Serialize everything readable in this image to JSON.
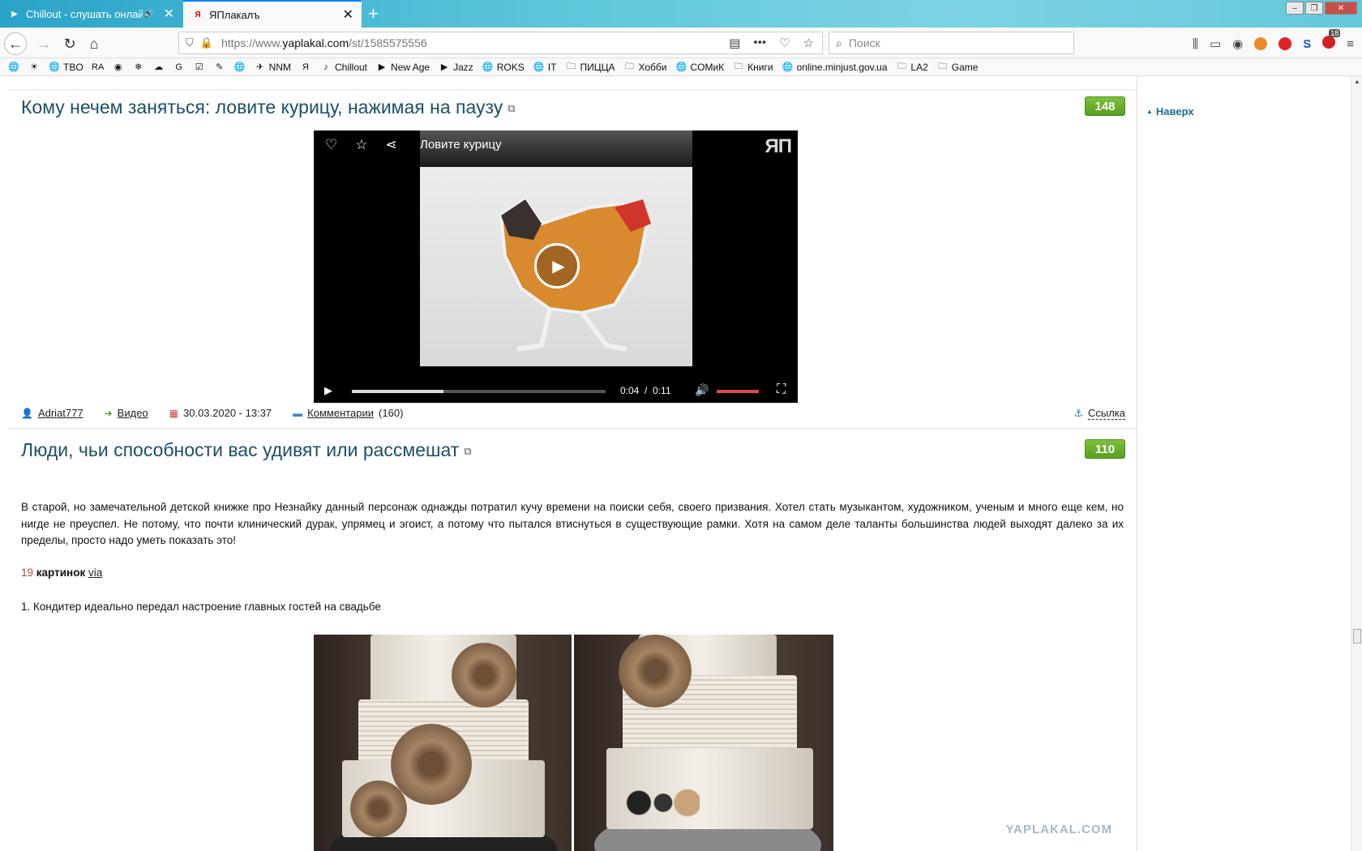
{
  "browser": {
    "tabs": [
      {
        "title": "Chillout - слушать онлай",
        "active": false
      },
      {
        "title": "ЯПлакалъ",
        "active": true
      }
    ],
    "url_prefix": "https://www.",
    "url_domain": "yaplakal.com",
    "url_path": "/st/1585575556",
    "search_placeholder": "Поиск",
    "abp_badge": "18",
    "bookmarks": [
      {
        "label": "",
        "icon": "globe-icon"
      },
      {
        "label": "",
        "icon": "sun-icon"
      },
      {
        "label": "TBO",
        "icon": "globe-icon"
      },
      {
        "label": "",
        "icon": "ra-icon"
      },
      {
        "label": "",
        "icon": "eye-icon"
      },
      {
        "label": "",
        "icon": "snowflake-icon"
      },
      {
        "label": "",
        "icon": "weather-icon"
      },
      {
        "label": "",
        "icon": "g-icon"
      },
      {
        "label": "",
        "icon": "check-icon"
      },
      {
        "label": "",
        "icon": "edit-icon"
      },
      {
        "label": "",
        "icon": "globe-icon"
      },
      {
        "label": "NNM",
        "icon": "bird-icon"
      },
      {
        "label": "",
        "icon": "yap-icon"
      },
      {
        "label": "Chillout",
        "icon": "guitar-icon"
      },
      {
        "label": "New Age",
        "icon": "play-circle-icon"
      },
      {
        "label": "Jazz",
        "icon": "play-circle-icon"
      },
      {
        "label": "ROKS",
        "icon": "globe-icon"
      },
      {
        "label": "IT",
        "icon": "globe-icon"
      },
      {
        "label": "ПИЦЦА",
        "icon": "folder-icon"
      },
      {
        "label": "Хобби",
        "icon": "folder-icon"
      },
      {
        "label": "COMиК",
        "icon": "globe-icon"
      },
      {
        "label": "Книги",
        "icon": "folder-icon"
      },
      {
        "label": "online.minjust.gov.ua",
        "icon": "globe-icon"
      },
      {
        "label": "LA2",
        "icon": "folder-icon"
      },
      {
        "label": "Game",
        "icon": "folder-icon"
      }
    ]
  },
  "sidebar": {
    "up_label": "Наверх"
  },
  "posts": {
    "p1": {
      "title": "Кому нечем заняться: ловите курицу, нажимая на паузу",
      "rating": "148",
      "video_title": "Ловите курицу",
      "video_logo": "ЯП",
      "time_current": "0:04",
      "time_sep": "/",
      "time_total": "0:11",
      "progress_fraction": 0.36,
      "author": "Adriat777",
      "category": "Видео",
      "date": "30.03.2020 - 13:37",
      "comments_label": "Комментарии",
      "comments_count": "(160)",
      "link_label": "Ссылка"
    },
    "p2": {
      "title": "Люди, чьи способности вас удивят или рассмешат",
      "rating": "110",
      "body": "В старой, но замечательной детской книжке про Незнайку данный персонаж однажды потратил кучу времени на поиски себя, своего призвания. Хотел стать музыкантом, художником, ученым и много еще кем, но нигде не преуспел. Не потому, что почти клинический дурак, упрямец и эгоист, а потому что пытался втиснуться в существующие рамки. Хотя на самом деле таланты большинства людей выходят далеко за их пределы, просто надо уметь показать это!",
      "count_num": "19",
      "count_label": "картинок",
      "via": "via",
      "item1": "1. Кондитер идеально передал настроение главных гостей на свадьбе"
    }
  },
  "watermark": "YAPLAKAL.COM",
  "colors": {
    "title": "#1c4f6a",
    "rating_bg": "#6db32e",
    "count_num": "#b8413a"
  }
}
